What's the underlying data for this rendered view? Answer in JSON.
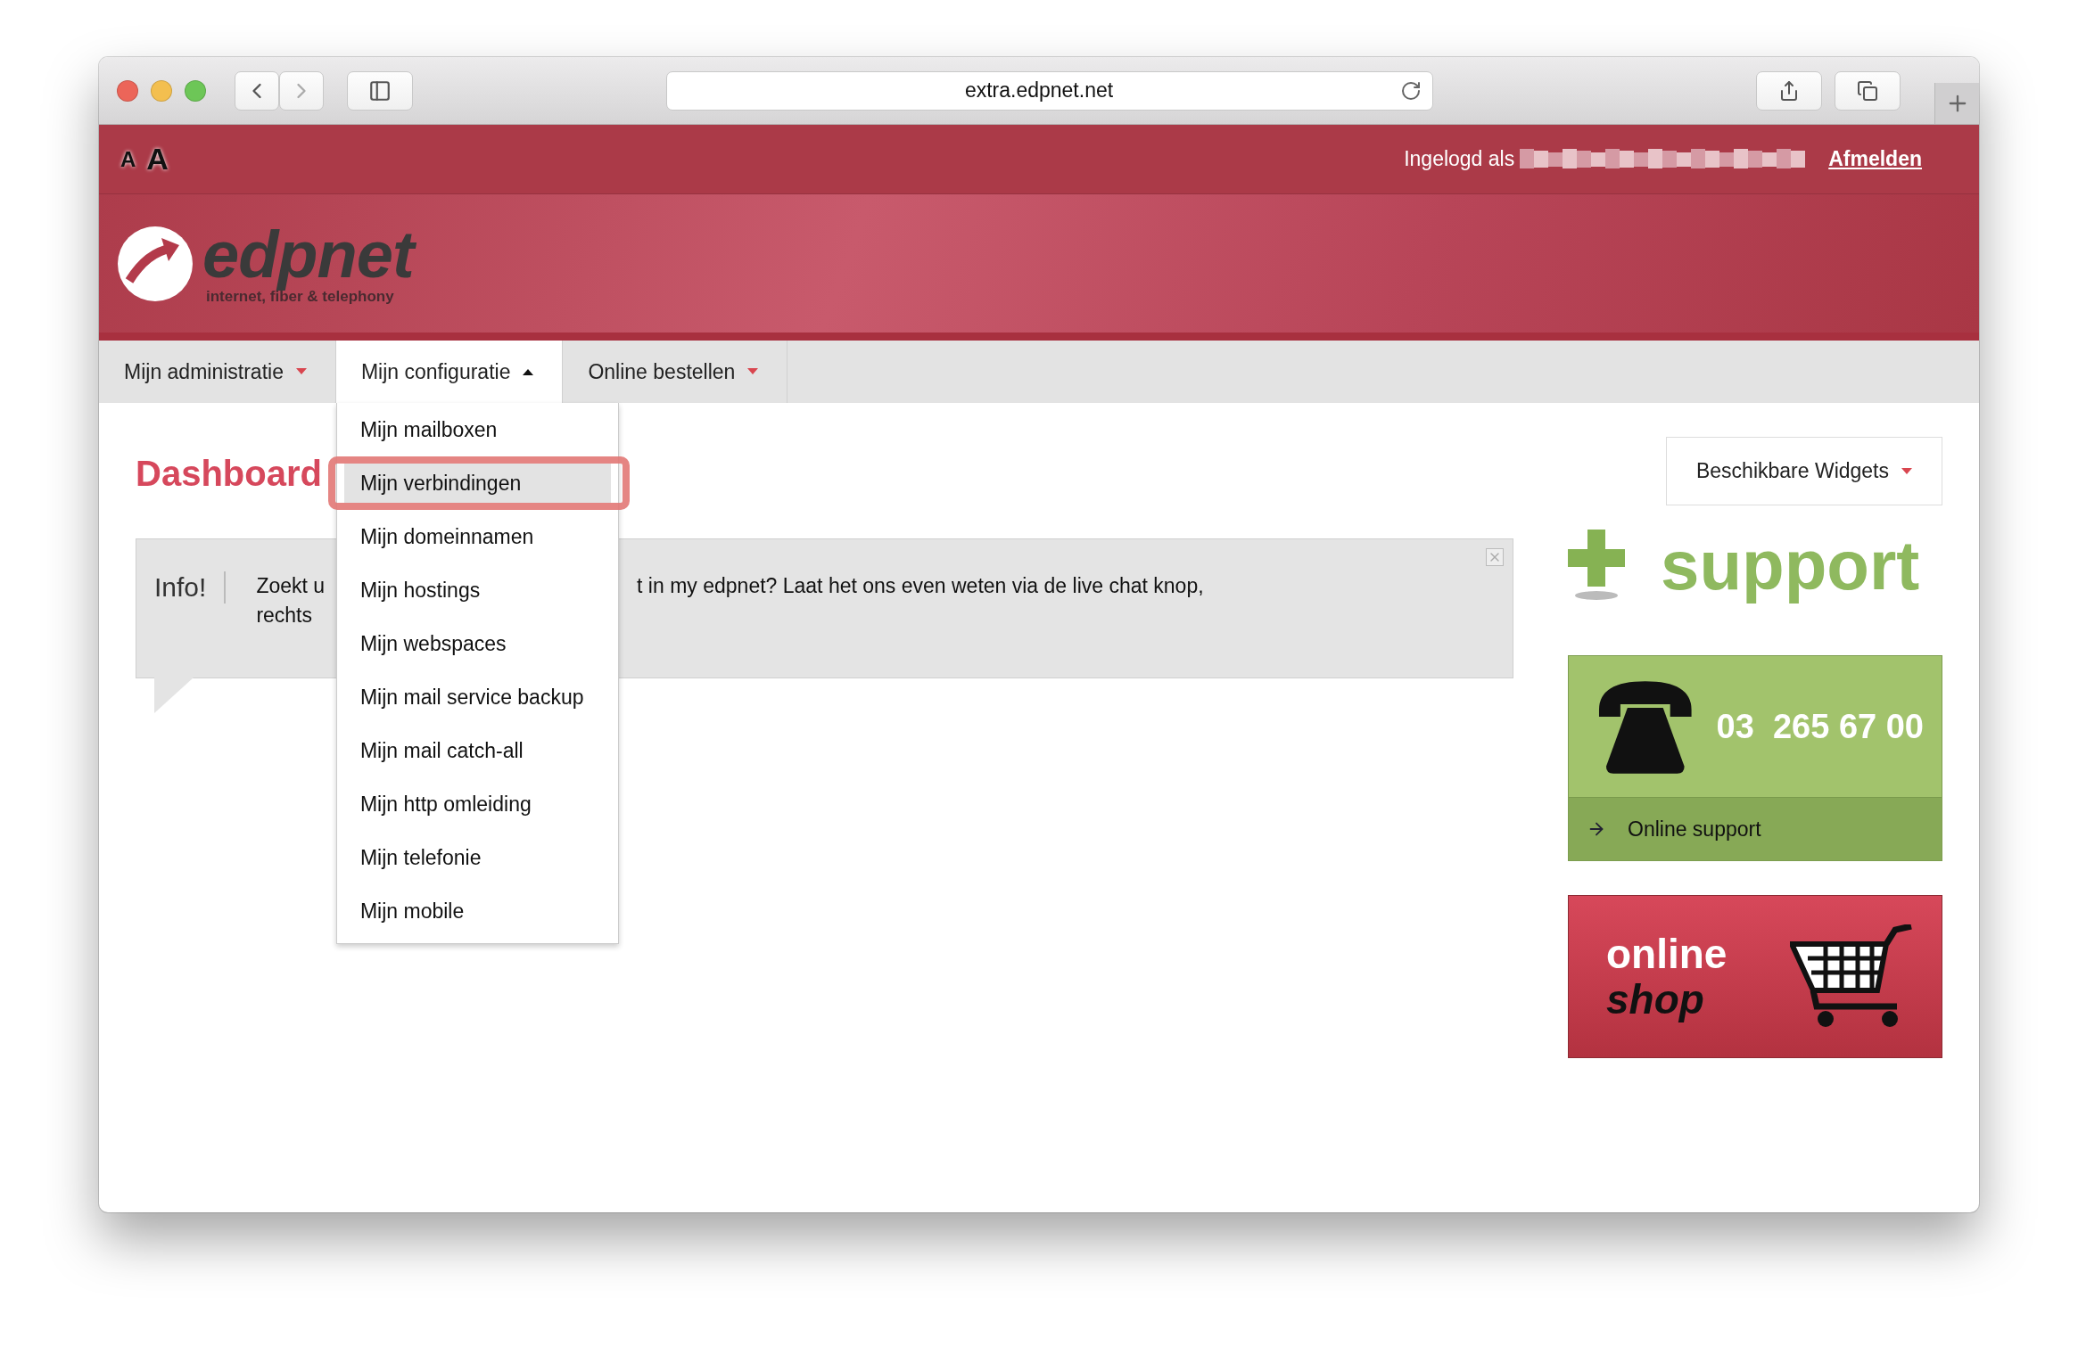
{
  "browser": {
    "url": "extra.edpnet.net"
  },
  "topbar": {
    "font_sizes": [
      "A",
      "A"
    ],
    "logged_in_label": "Ingelogd als",
    "logout": "Afmelden"
  },
  "logo": {
    "name": "edpnet",
    "tagline": "internet, fiber & telephony"
  },
  "nav": [
    {
      "label": "Mijn administratie",
      "expanded": false
    },
    {
      "label": "Mijn configuratie",
      "expanded": true
    },
    {
      "label": "Online bestellen",
      "expanded": false
    }
  ],
  "dropdown": {
    "items": [
      {
        "label": "Mijn mailboxen",
        "selected": false
      },
      {
        "label": "Mijn verbindingen",
        "selected": true
      },
      {
        "label": "Mijn domeinnamen",
        "selected": false
      },
      {
        "label": "Mijn hostings",
        "selected": false
      },
      {
        "label": "Mijn webspaces",
        "selected": false
      },
      {
        "label": "Mijn mail service backup",
        "selected": false
      },
      {
        "label": "Mijn mail catch-all",
        "selected": false
      },
      {
        "label": "Mijn http omleiding",
        "selected": false
      },
      {
        "label": "Mijn telefonie",
        "selected": false
      },
      {
        "label": "Mijn mobile",
        "selected": false
      }
    ]
  },
  "page_title": "Dashboard",
  "info": {
    "label": "Info!",
    "text_left": [
      "Zoekt u",
      "rechts"
    ],
    "text_right": "t in my edpnet? Laat het ons even weten via de live chat knop,"
  },
  "widgets_button": "Beschikbare Widgets",
  "support": {
    "title": "support",
    "phone": "03  265 67 00",
    "link": "Online support"
  },
  "shop": {
    "line1": "online",
    "line2": "shop"
  }
}
